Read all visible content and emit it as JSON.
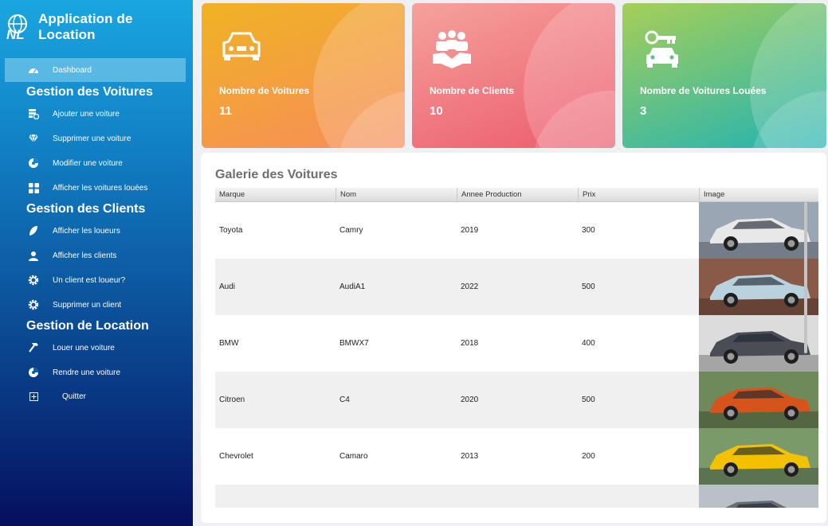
{
  "app": {
    "title": "Application de Location",
    "logo_text": "NL"
  },
  "sidebar": {
    "dashboard": {
      "label": "Dashboard",
      "icon": "dashboard-icon"
    },
    "sections": [
      {
        "title": "Gestion des Voitures",
        "items": [
          {
            "label": "Ajouter une voiture",
            "icon": "add-car-icon"
          },
          {
            "label": "Supprimer une voiture",
            "icon": "delete-car-icon"
          },
          {
            "label": "Modifier une voiture",
            "icon": "edit-car-icon"
          },
          {
            "label": "Afficher les voitures louées",
            "icon": "grid-icon"
          }
        ]
      },
      {
        "title": "Gestion des Clients",
        "items": [
          {
            "label": "Afficher les loueurs",
            "icon": "renters-icon"
          },
          {
            "label": "Afficher les clients",
            "icon": "user-icon"
          },
          {
            "label": "Un client est loueur?",
            "icon": "gear-icon"
          },
          {
            "label": "Supprimer un client",
            "icon": "gear-icon"
          }
        ]
      },
      {
        "title": "Gestion de Location",
        "items": [
          {
            "label": "Louer une voiture",
            "icon": "hammer-icon"
          },
          {
            "label": "Rendre une voiture",
            "icon": "return-icon"
          },
          {
            "label": "Quitter",
            "icon": "exit-icon"
          }
        ]
      }
    ]
  },
  "stats": [
    {
      "title": "Nombre de Voitures",
      "value": "11",
      "icon": "car-icon",
      "color_from": "#f0b323",
      "color_to": "#f78d5a"
    },
    {
      "title": "Nombre de Clients",
      "value": "10",
      "icon": "handshake-icon",
      "color_from": "#f5a29c",
      "color_to": "#ec5a6c"
    },
    {
      "title": "Nombre de Voitures Louées",
      "value": "3",
      "icon": "car-key-icon",
      "color_from": "#9ecb5a",
      "color_to": "#22b3b3"
    }
  ],
  "gallery": {
    "title": "Galerie des Voitures",
    "columns": [
      "Marque",
      "Nom",
      "Annee Production",
      "Prix",
      "Image"
    ],
    "rows": [
      {
        "marque": "Toyota",
        "nom": "Camry",
        "annee": "2019",
        "prix": "300",
        "car_color": "#e8e8e8",
        "bg": "#9aa6b4"
      },
      {
        "marque": "Audi",
        "nom": "AudiA1",
        "annee": "2022",
        "prix": "500",
        "car_color": "#b9d3de",
        "bg": "#8a5a48"
      },
      {
        "marque": "BMW",
        "nom": "BMWX7",
        "annee": "2018",
        "prix": "400",
        "car_color": "#4a4d55",
        "bg": "#dcdcdc"
      },
      {
        "marque": "Citroen",
        "nom": "C4",
        "annee": "2020",
        "prix": "500",
        "car_color": "#d4541c",
        "bg": "#6f8a5a"
      },
      {
        "marque": "Chevrolet",
        "nom": "Camaro",
        "annee": "2013",
        "prix": "200",
        "car_color": "#f2c200",
        "bg": "#7a9a6a"
      },
      {
        "marque": "",
        "nom": "",
        "annee": "",
        "prix": "",
        "car_color": "#6a6d75",
        "bg": "#b8c0c8"
      }
    ]
  }
}
